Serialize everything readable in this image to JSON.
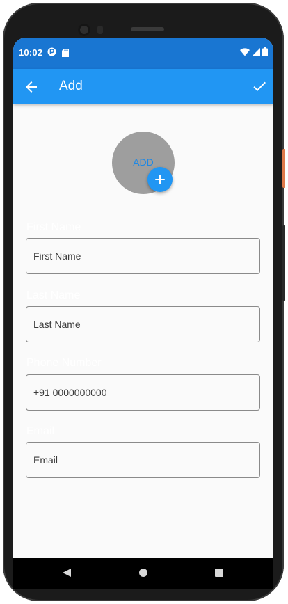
{
  "status_bar": {
    "time": "10:02",
    "icons_left": [
      "pin-circle-icon",
      "sd-card-icon"
    ],
    "icons_right": [
      "wifi-icon",
      "cell-signal-icon",
      "battery-icon"
    ]
  },
  "app_bar": {
    "title": "Add",
    "back_icon": "arrow-back-icon",
    "confirm_icon": "check-icon"
  },
  "avatar": {
    "label": "ADD",
    "fab_icon": "plus-icon"
  },
  "form": {
    "fields": [
      {
        "label": "First Name",
        "placeholder": "First Name"
      },
      {
        "label": "Last Name",
        "placeholder": "Last Name"
      },
      {
        "label": "Phone Number",
        "placeholder": "+91 0000000000"
      },
      {
        "label": "Email",
        "placeholder": "Email"
      }
    ]
  },
  "nav_bar": {
    "icons": [
      "nav-back-icon",
      "nav-home-icon",
      "nav-recent-icon"
    ]
  },
  "colors": {
    "primary": "#2196f3",
    "primary_dark": "#1976d2",
    "avatar_bg": "#9e9e9e",
    "background": "#fafafa"
  }
}
